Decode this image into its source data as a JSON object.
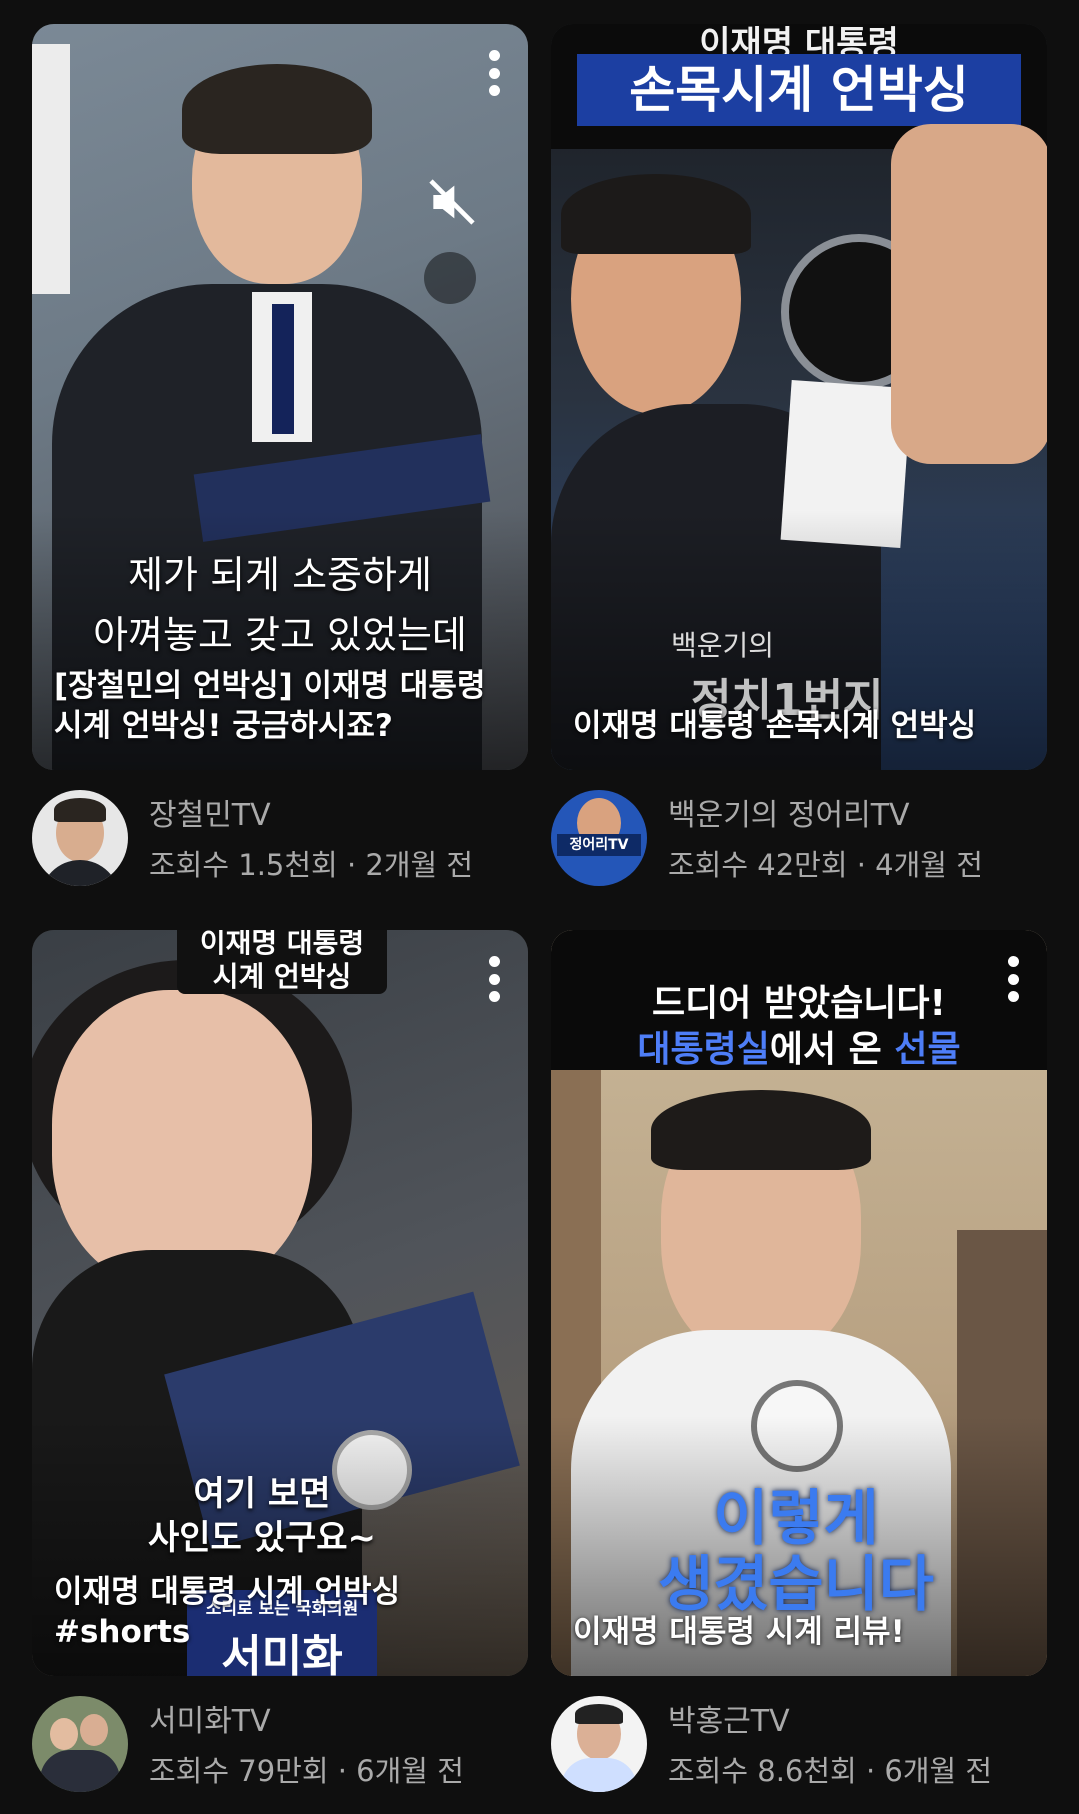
{
  "colors": {
    "background": "#0f0f0f",
    "secondary_text": "#aaaaaa"
  },
  "videos": [
    {
      "title": "[장철민의 언박싱] 이재명 대통령 시계 언박싱! 궁금하시죠?",
      "channel": "장철민TV",
      "stats": "조회수 1.5천회 · 2개월 전",
      "overlay_lines": [
        "제가 되게 소중하게",
        "아껴놓고 갖고 있었는데"
      ],
      "icons": [
        "more-vert-icon",
        "mute-icon"
      ]
    },
    {
      "title": "이재명 대통령 손목시계 언박싱",
      "channel": "백운기의 정어리TV",
      "stats": "조회수 42만회 · 4개월 전",
      "overlay_top": "이재명 대통령",
      "overlay_banner": "손목시계 언박싱",
      "overlay_bottom_small": "백운기의",
      "overlay_bottom": "정치1번지",
      "avatar_label": "정어리TV"
    },
    {
      "title": "이재명 대통령 시계 언박싱 #shorts",
      "channel": "서미화TV",
      "stats": "조회수 79만회 · 6개월 전",
      "overlay_top": "이재명 대통령\n시계 언박싱",
      "overlay_mid": "여기 보면\n사인도 있구요~",
      "overlay_bottom_small": "소리로 보는 국회의원",
      "overlay_bottom": "서미화"
    },
    {
      "title": "이재명 대통령 시계 리뷰!",
      "channel": "박홍근TV",
      "stats": "조회수 8.6천회 · 6개월 전",
      "overlay_top": "드디어 받았습니다!",
      "overlay_sub_a": "대통령실",
      "overlay_sub_b": "에서 온",
      "overlay_sub_c": "선물",
      "overlay_big": "이렇게\n생겼습니다"
    }
  ]
}
